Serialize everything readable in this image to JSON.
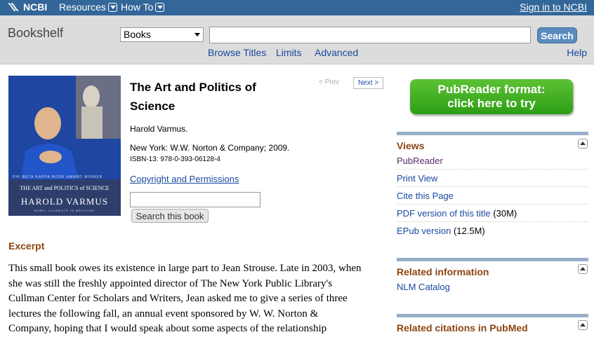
{
  "topbar": {
    "logo_text": "NCBI",
    "menu_resources": "Resources",
    "menu_howto": "How To",
    "signin": "Sign in to NCBI"
  },
  "search": {
    "section": "Bookshelf",
    "database": "Books",
    "button": "Search",
    "browse_titles": "Browse Titles",
    "limits": "Limits",
    "advanced": "Advanced",
    "help": "Help"
  },
  "cover": {
    "award": "PHI BETA KAPPA BOOK AWARD WINNER",
    "title": "THE ART and POLITICS of SCIENCE",
    "author": "HAROLD VARMUS",
    "subtitle": "NOBEL LAUREATE IN MEDICINE"
  },
  "book": {
    "title": "The Art and Politics of Science",
    "prev": "< Prev",
    "next": "Next >",
    "author": "Harold Varmus.",
    "publisher": "New York: W.W. Norton & Company; 2009.",
    "isbn": "ISBN-13: 978-0-393-06128-4",
    "copyright": "Copyright and Permissions",
    "search_button": "Search this book"
  },
  "excerpt": {
    "heading": "Excerpt",
    "lines": [
      "This small book owes its existence in large part to Jean Strouse. Late in 2003, when",
      "she was still the freshly appointed director of The New York Public Library's",
      "Cullman Center for Scholars and Writers, Jean asked me to give a series of three",
      "lectures the following fall, an annual event sponsored by W. W. Norton &",
      "Company, hoping that I would speak about some aspects of the relationship"
    ]
  },
  "sidebar": {
    "pubreader_line1": "PubReader format:",
    "pubreader_line2": "click here to try",
    "views_heading": "Views",
    "views": {
      "pubreader": "PubReader",
      "print": "Print View",
      "cite": "Cite this Page",
      "pdf": "PDF version of this title",
      "pdf_size": "(30M)",
      "epub": "EPub version",
      "epub_size": "(12.5M)"
    },
    "related_info_heading": "Related information",
    "nlm_catalog": "NLM Catalog",
    "related_citations_heading": "Related citations in PubMed"
  },
  "colors": {
    "topbar": "#336699",
    "link": "#1a4aa0",
    "heading": "#8b4513",
    "pubreader_green": "#3aa820"
  }
}
